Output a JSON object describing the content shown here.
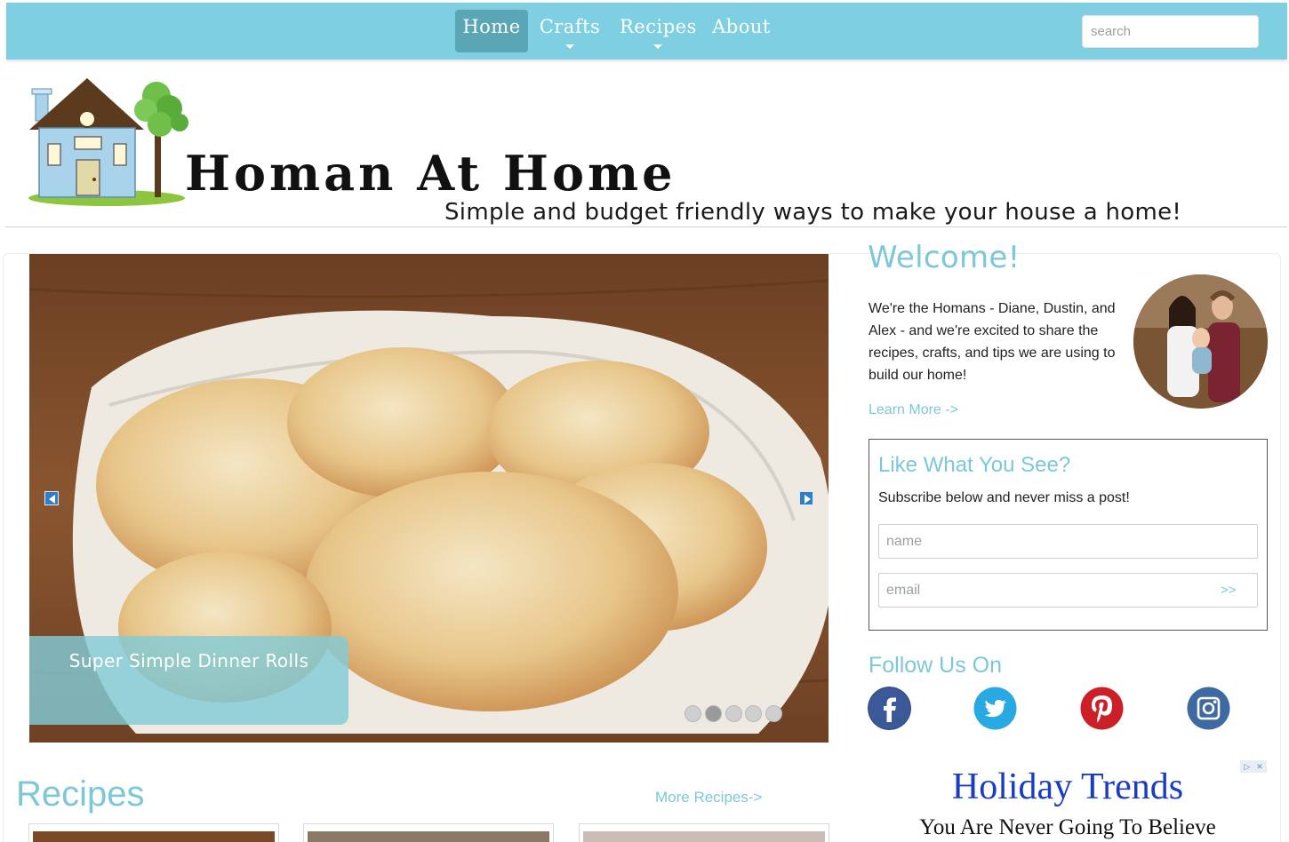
{
  "nav": {
    "items": [
      {
        "label": "Home",
        "active": true,
        "has_dropdown": false
      },
      {
        "label": "Crafts",
        "active": false,
        "has_dropdown": true
      },
      {
        "label": "Recipes",
        "active": false,
        "has_dropdown": true
      },
      {
        "label": "About",
        "active": false,
        "has_dropdown": false
      }
    ],
    "search_placeholder": "search"
  },
  "header": {
    "title": "Homan At Home",
    "tagline": "Simple and budget friendly ways to make your house a home!"
  },
  "slider": {
    "caption": "Super Simple Dinner Rolls",
    "dot_count": 5,
    "active_dot": 1
  },
  "recipes": {
    "heading": "Recipes",
    "more_link": "More Recipes->"
  },
  "sidebar": {
    "welcome_title": "Welcome!",
    "welcome_text": "We're the Homans - Diane, Dustin, and Alex - and we're excited to share the recipes, crafts, and tips we are using to build our home!",
    "learn_more": "Learn More ->",
    "subscribe": {
      "title": "Like What You See?",
      "text": "Subscribe below and never miss a post!",
      "name_placeholder": "name",
      "email_placeholder": "email",
      "submit_label": ">>"
    },
    "follow_title": "Follow Us On",
    "social": [
      "facebook-icon",
      "twitter-icon",
      "pinterest-icon",
      "instagram-icon"
    ]
  },
  "ad": {
    "headline": "Holiday Trends",
    "subheadline": "You Are Never Going To Believe"
  },
  "colors": {
    "nav_bg": "#7dcfe1",
    "nav_active": "#5aa6b4",
    "accent": "#7cc8d8",
    "ad_link": "#1a3cc2"
  }
}
